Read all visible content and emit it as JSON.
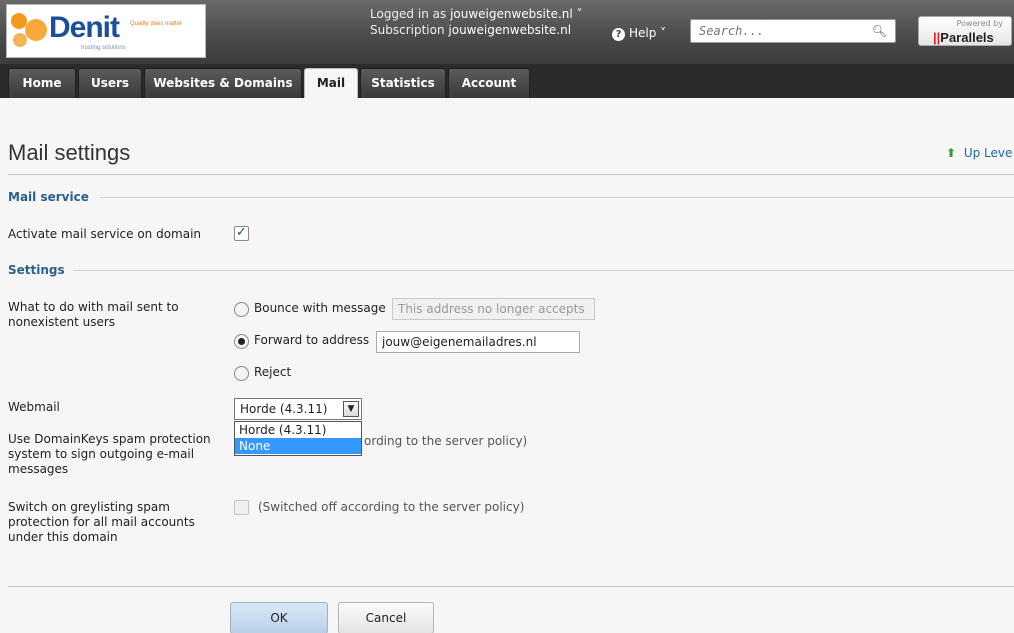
{
  "header": {
    "logo_brand": "Denit",
    "logo_tagline": "Quality does matter",
    "logo_sub": "hosting solutions",
    "logged_in_label": "Logged in as",
    "logged_in_user": "jouweigenwebsite.nl ˅",
    "subscription_label": "Subscription",
    "subscription_value": "jouweigenwebsite.nl",
    "help_label": "Help ˅",
    "search_placeholder": "Search...",
    "powered_by": "Powered by",
    "parallels": "Parallels"
  },
  "tabs": [
    {
      "label": "Home"
    },
    {
      "label": "Users"
    },
    {
      "label": "Websites & Domains"
    },
    {
      "label": "Mail"
    },
    {
      "label": "Statistics"
    },
    {
      "label": "Account"
    }
  ],
  "page": {
    "title": "Mail settings",
    "up_level": "Up Leve"
  },
  "mail_service": {
    "section": "Mail service",
    "activate_label": "Activate mail service on domain",
    "activate_checked": true
  },
  "settings": {
    "section": "Settings",
    "nonexistent_label": "What to do with mail sent to nonexistent users",
    "bounce_label": "Bounce with message",
    "bounce_value": "This address no longer accepts",
    "forward_label": "Forward to address",
    "forward_value": "jouw@eigenemailadres.nl",
    "reject_label": "Reject",
    "selected_option": "forward",
    "webmail_label": "Webmail",
    "webmail_selected": "Horde (4.3.11)",
    "webmail_options": [
      "Horde (4.3.11)",
      "None"
    ],
    "webmail_highlighted": "None",
    "domainkeys_label": "Use DomainKeys spam protection system to sign outgoing e-mail messages",
    "domainkeys_note": "ording to the server policy)",
    "greylisting_label": "Switch on greylisting spam protection for all mail accounts under this domain",
    "greylisting_note": "(Switched off according to the server policy)"
  },
  "buttons": {
    "ok": "OK",
    "cancel": "Cancel"
  }
}
